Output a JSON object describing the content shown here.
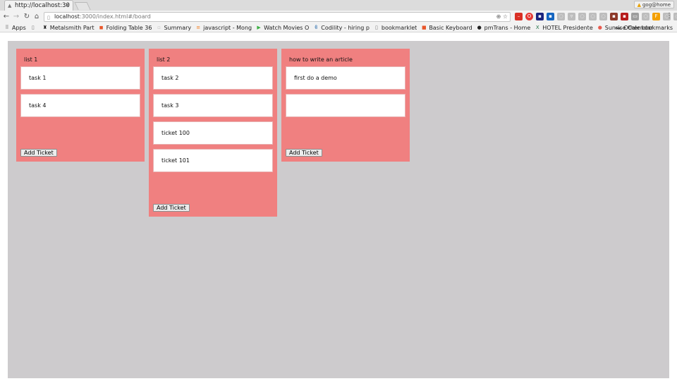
{
  "browser": {
    "tab_title": "http://localhost:30",
    "profile_name": "gog@home",
    "url_host": "localhost",
    "url_path": ":3000/index.html#/board",
    "bookmarks": [
      {
        "label": "Apps",
        "icon": "apps-grid-icon",
        "color": "#555555"
      },
      {
        "label": "",
        "icon": "page-icon",
        "color": "#777777"
      },
      {
        "label": "Metalsmith Part",
        "icon": "metalsmith-icon",
        "color": "#222222"
      },
      {
        "label": "Folding Table 36",
        "icon": "shop-icon",
        "color": "#e8562a"
      },
      {
        "label": "Summary",
        "icon": "blank-page-icon",
        "color": "#bbbbbb"
      },
      {
        "label": "javascript - Mong",
        "icon": "stackoverflow-icon",
        "color": "#f48024"
      },
      {
        "label": "Watch Movies O",
        "icon": "play-icon",
        "color": "#3cb043"
      },
      {
        "label": "Codility - hiring p",
        "icon": "codility-icon",
        "color": "#2266aa"
      },
      {
        "label": "bookmarklet",
        "icon": "page-icon",
        "color": "#777777"
      },
      {
        "label": "Basic Keyboard",
        "icon": "keyboard-icon",
        "color": "#e8562a"
      },
      {
        "label": "pmTrans - Home",
        "icon": "github-icon",
        "color": "#222222"
      },
      {
        "label": "HOTEL Presidente",
        "icon": "excel-icon",
        "color": "#1e7145"
      },
      {
        "label": "Sunrise Calendar",
        "icon": "calendar-icon",
        "color": "#e95b4f"
      }
    ],
    "bookmarks_more": "»",
    "other_bookmarks": "Other bookmarks"
  },
  "board": {
    "lists": [
      {
        "title": "list 1",
        "cards": [
          "task 1",
          "task 4"
        ],
        "add_label": "Add Ticket"
      },
      {
        "title": "list 2",
        "cards": [
          "task 2",
          "task 3",
          "ticket 100",
          "ticket 101"
        ],
        "add_label": "Add Ticket"
      },
      {
        "title": "how to write an article",
        "cards": [
          "first do a demo",
          ""
        ],
        "add_label": "Add Ticket"
      }
    ]
  },
  "colors": {
    "list_bg": "#f08080",
    "board_bg": "#cdcbcd",
    "card_bg": "#ffffff"
  }
}
